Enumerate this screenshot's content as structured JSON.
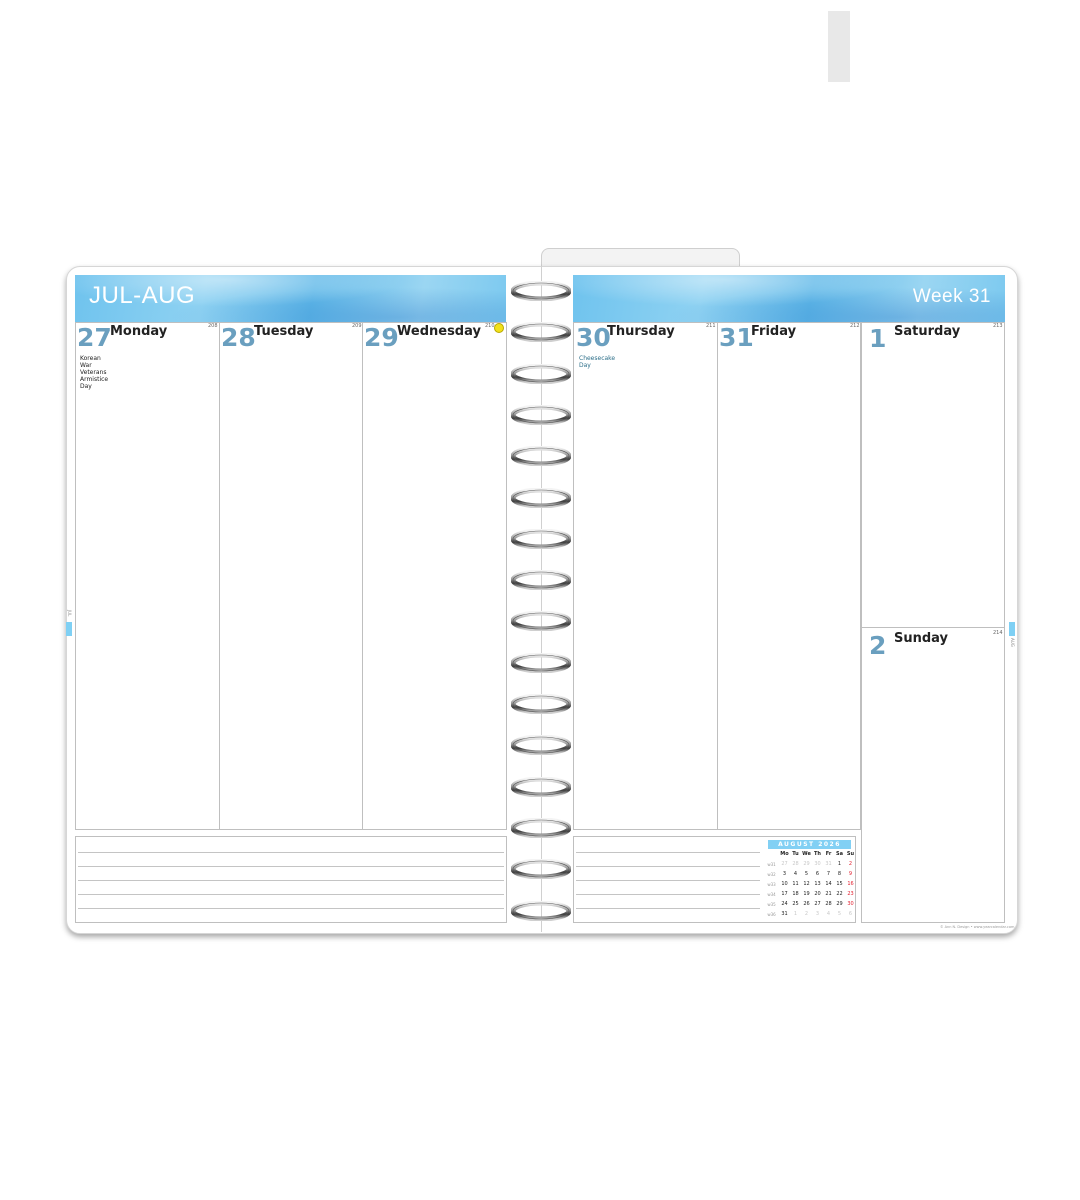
{
  "header": {
    "left_title": "JUL-AUG",
    "right_title": "Week 31"
  },
  "days": [
    {
      "num": "27",
      "name": "Monday",
      "doy": "208",
      "holiday": "Korean War Veterans Armistice Day"
    },
    {
      "num": "28",
      "name": "Tuesday",
      "doy": "209",
      "holiday": ""
    },
    {
      "num": "29",
      "name": "Wednesday",
      "doy": "210",
      "holiday": ""
    },
    {
      "num": "30",
      "name": "Thursday",
      "doy": "211",
      "holiday": "Cheesecake Day"
    },
    {
      "num": "31",
      "name": "Friday",
      "doy": "212",
      "holiday": ""
    },
    {
      "num": "1",
      "name": "Saturday",
      "doy": "213",
      "holiday": ""
    },
    {
      "num": "2",
      "name": "Sunday",
      "doy": "214",
      "holiday": ""
    }
  ],
  "moon_phase_icon": "full-moon-icon",
  "side_tab_left": "JUL",
  "side_tab_right": "AUG",
  "mini_calendar": {
    "title": "AUGUST 2026",
    "weekday_headers": [
      "Mo",
      "Tu",
      "We",
      "Th",
      "Fr",
      "Sa",
      "Su"
    ],
    "weeks": [
      {
        "wk": "w31",
        "days": [
          "27",
          "28",
          "29",
          "30",
          "31",
          "1",
          "2"
        ],
        "dim": [
          true,
          true,
          true,
          true,
          true,
          false,
          false
        ]
      },
      {
        "wk": "w32",
        "days": [
          "3",
          "4",
          "5",
          "6",
          "7",
          "8",
          "9"
        ],
        "dim": [
          false,
          false,
          false,
          false,
          false,
          false,
          false
        ]
      },
      {
        "wk": "w33",
        "days": [
          "10",
          "11",
          "12",
          "13",
          "14",
          "15",
          "16"
        ],
        "dim": [
          false,
          false,
          false,
          false,
          false,
          false,
          false
        ]
      },
      {
        "wk": "w34",
        "days": [
          "17",
          "18",
          "19",
          "20",
          "21",
          "22",
          "23"
        ],
        "dim": [
          false,
          false,
          false,
          false,
          false,
          false,
          false
        ]
      },
      {
        "wk": "w35",
        "days": [
          "24",
          "25",
          "26",
          "27",
          "28",
          "29",
          "30"
        ],
        "dim": [
          false,
          false,
          false,
          false,
          false,
          false,
          false
        ]
      },
      {
        "wk": "w36",
        "days": [
          "31",
          "1",
          "2",
          "3",
          "4",
          "5",
          "6"
        ],
        "dim": [
          false,
          true,
          true,
          true,
          true,
          true,
          true
        ]
      }
    ]
  },
  "footer": "© Ann N. Design • www.yearcalendar.com",
  "colors": {
    "accent": "#6a9fbf",
    "banner": "#7cc9ef",
    "weekend_red": "#e21d2d"
  }
}
